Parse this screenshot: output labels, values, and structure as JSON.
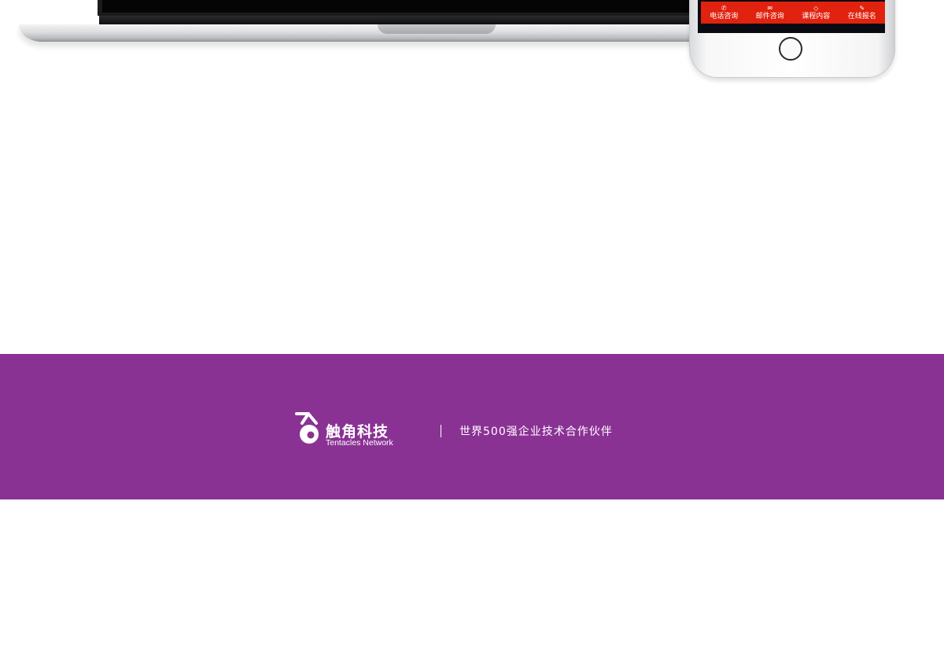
{
  "phone": {
    "bottom_nav": [
      {
        "label": "电话咨询",
        "icon": "phone-icon",
        "glyph": "✆"
      },
      {
        "label": "邮件咨询",
        "icon": "mail-icon",
        "glyph": "✉"
      },
      {
        "label": "课程内容",
        "icon": "diamond-icon",
        "glyph": "◇"
      },
      {
        "label": "在线报名",
        "icon": "edit-icon",
        "glyph": "✎"
      }
    ]
  },
  "footer": {
    "brand_cn": "触角科技",
    "brand_en": "Tentacles Network",
    "slogan": "世界500强企业技术合作伙伴"
  },
  "colors": {
    "footer_band": "#8a3294",
    "phone_nav_bar": "#e0220f"
  }
}
